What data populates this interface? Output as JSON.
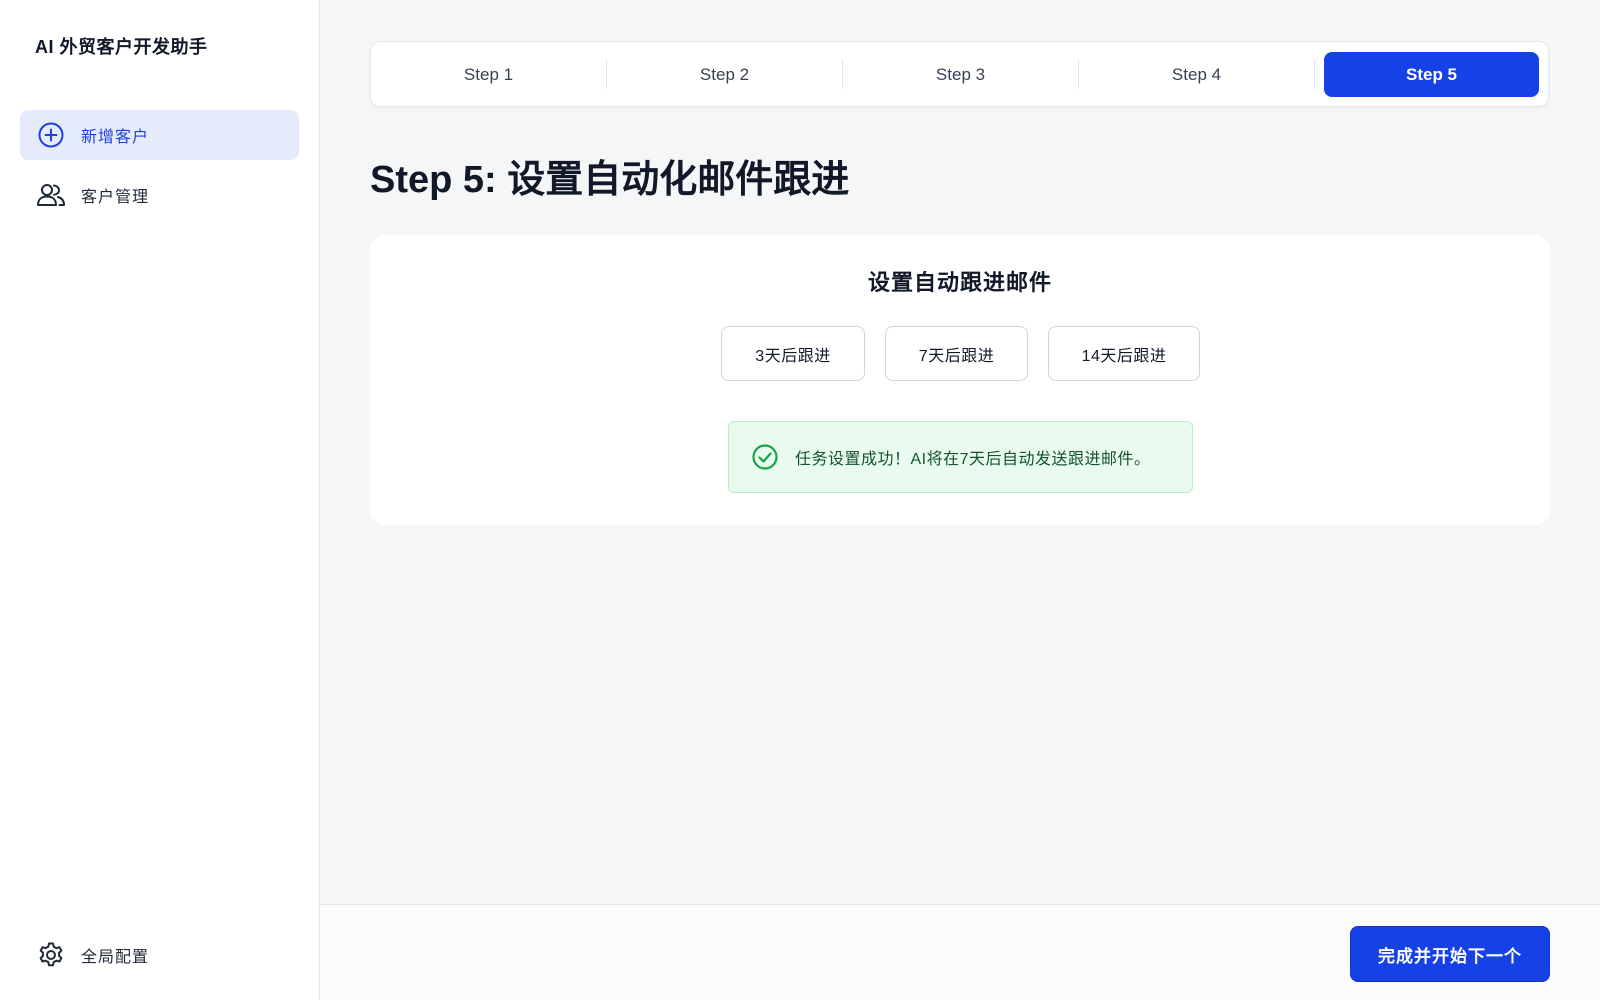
{
  "app": {
    "title": "AI 外贸客户开发助手"
  },
  "sidebar": {
    "items": [
      {
        "label": "新增客户",
        "icon": "plus-circle-icon",
        "active": true
      },
      {
        "label": "客户管理",
        "icon": "users-icon",
        "active": false
      }
    ],
    "settings": {
      "label": "全局配置",
      "icon": "gear-icon"
    }
  },
  "stepper": {
    "steps": [
      "Step 1",
      "Step 2",
      "Step 3",
      "Step 4",
      "Step 5"
    ],
    "current": 5
  },
  "page": {
    "title": "Step 5: 设置自动化邮件跟进"
  },
  "followup": {
    "title": "设置自动跟进邮件",
    "options": [
      "3天后跟进",
      "7天后跟进",
      "14天后跟进"
    ],
    "success_message": "任务设置成功！AI将在7天后自动发送跟进邮件。",
    "success_icon": "check-circle-icon"
  },
  "footer": {
    "primary_label": "完成并开始下一个"
  },
  "colors": {
    "primary": "#1641e6",
    "active_nav_bg": "#e6ebfb",
    "success_bg": "#e8fbee",
    "success_fg": "#14532d",
    "success_icon": "#16a34a"
  }
}
